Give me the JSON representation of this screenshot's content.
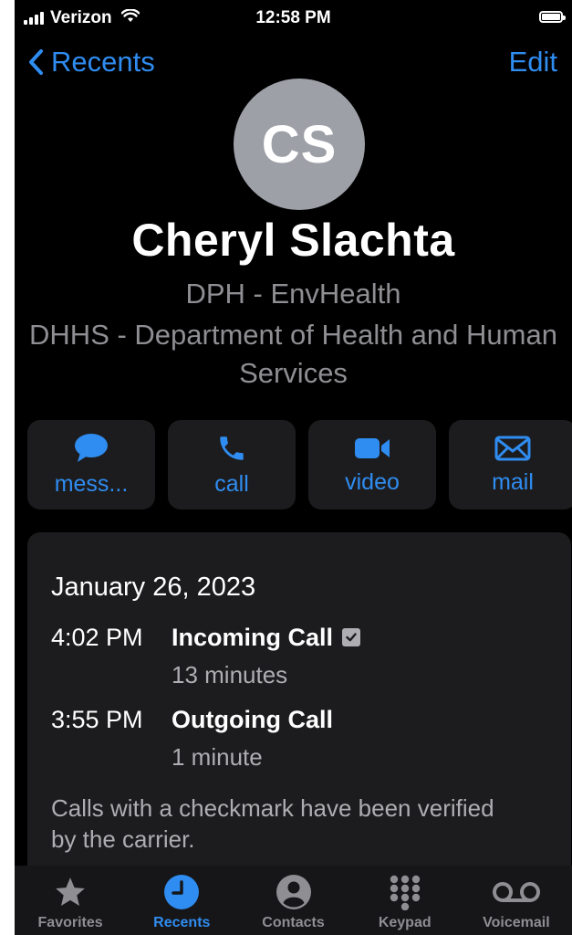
{
  "status_bar": {
    "carrier": "Verizon",
    "time": "12:58 PM"
  },
  "nav": {
    "back_label": "Recents",
    "edit_label": "Edit"
  },
  "contact": {
    "initials": "CS",
    "name": "Cheryl Slachta",
    "department": "DPH - EnvHealth",
    "organization": "DHHS - Department of Health and Human Services"
  },
  "actions": [
    {
      "label": "mess...",
      "icon": "message-bubble-icon"
    },
    {
      "label": "call",
      "icon": "phone-icon"
    },
    {
      "label": "video",
      "icon": "video-camera-icon"
    },
    {
      "label": "mail",
      "icon": "envelope-icon"
    }
  ],
  "call_history": {
    "date": "January 26, 2023",
    "calls": [
      {
        "time": "4:02 PM",
        "type": "Incoming Call",
        "duration": "13 minutes",
        "verified": true
      },
      {
        "time": "3:55 PM",
        "type": "Outgoing Call",
        "duration": "1 minute",
        "verified": false
      }
    ],
    "note": "Calls with a checkmark have been verified by the carrier."
  },
  "tab_bar": [
    {
      "label": "Favorites",
      "icon": "star-icon",
      "active": false
    },
    {
      "label": "Recents",
      "icon": "clock-icon",
      "active": true
    },
    {
      "label": "Contacts",
      "icon": "person-icon",
      "active": false
    },
    {
      "label": "Keypad",
      "icon": "keypad-icon",
      "active": false
    },
    {
      "label": "Voicemail",
      "icon": "voicemail-icon",
      "active": false
    }
  ],
  "colors": {
    "accent": "#2f8cf0",
    "background": "#000000",
    "card": "#1c1c1e",
    "secondary_text": "#8e8e93"
  }
}
